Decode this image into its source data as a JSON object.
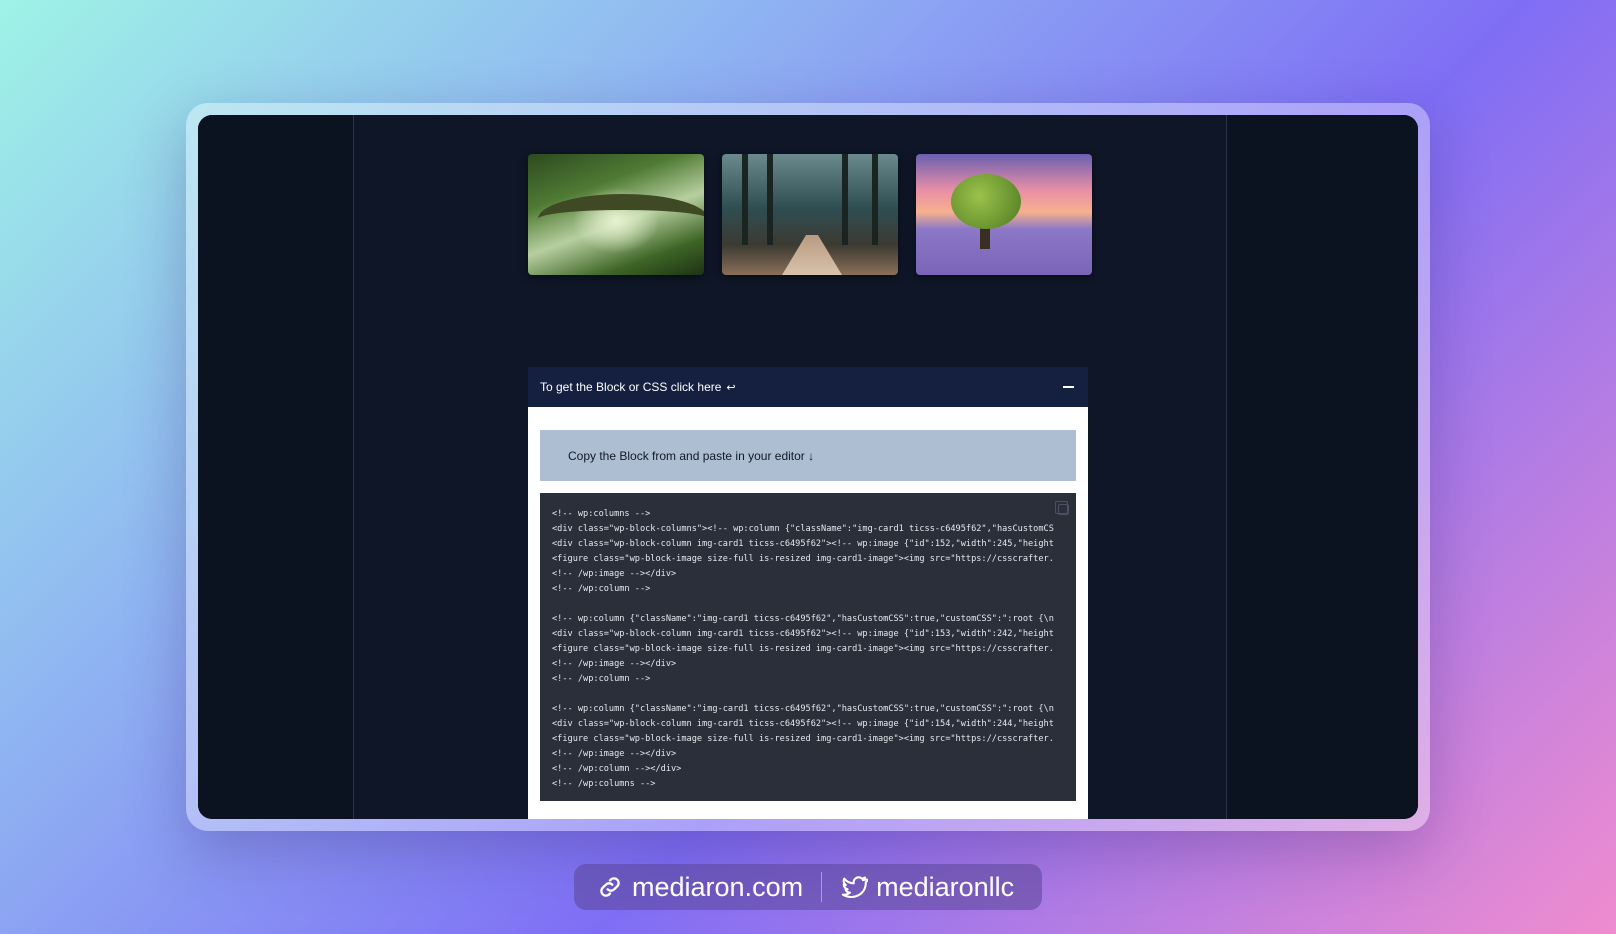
{
  "accordion": {
    "title": "To get the Block or CSS click here",
    "link_glyph": "↩",
    "notice": "Copy the Block from and paste in your editor ↓"
  },
  "code_lines": [
    "<!-- wp:columns -->",
    "<div class=\"wp-block-columns\"><!-- wp:column {\"className\":\"img-card1 ticss-c6495f62\",\"hasCustomCS",
    "<div class=\"wp-block-column img-card1 ticss-c6495f62\"><!-- wp:image {\"id\":152,\"width\":245,\"height",
    "<figure class=\"wp-block-image size-full is-resized img-card1-image\"><img src=\"https://csscrafter.",
    "<!-- /wp:image --></div>",
    "<!-- /wp:column -->",
    "",
    "<!-- wp:column {\"className\":\"img-card1 ticss-c6495f62\",\"hasCustomCSS\":true,\"customCSS\":\":root {\\n",
    "<div class=\"wp-block-column img-card1 ticss-c6495f62\"><!-- wp:image {\"id\":153,\"width\":242,\"height",
    "<figure class=\"wp-block-image size-full is-resized img-card1-image\"><img src=\"https://csscrafter.",
    "<!-- /wp:image --></div>",
    "<!-- /wp:column -->",
    "",
    "<!-- wp:column {\"className\":\"img-card1 ticss-c6495f62\",\"hasCustomCSS\":true,\"customCSS\":\":root {\\n",
    "<div class=\"wp-block-column img-card1 ticss-c6495f62\"><!-- wp:image {\"id\":154,\"width\":244,\"height",
    "<figure class=\"wp-block-image size-full is-resized img-card1-image\"><img src=\"https://csscrafter.",
    "<!-- /wp:image --></div>",
    "<!-- /wp:column --></div>",
    "<!-- /wp:columns -->"
  ],
  "footer": {
    "website": "mediaron.com",
    "twitter": "mediaronllc"
  },
  "colors": {
    "screen_bg": "#0e1627",
    "accordion_header": "#152041",
    "notice_bg": "#adbdd2",
    "code_bg": "#2b2f3a"
  }
}
